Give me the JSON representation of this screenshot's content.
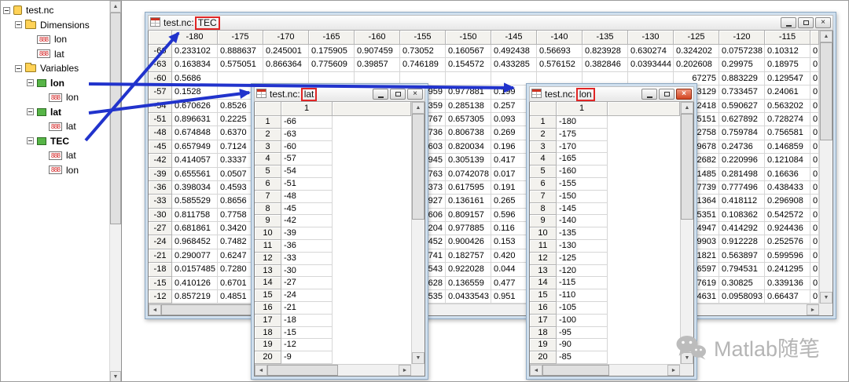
{
  "tree": {
    "items": [
      {
        "depth": 0,
        "label": "test.nc",
        "icon": "file",
        "expander": true,
        "bold": false
      },
      {
        "depth": 1,
        "label": "Dimensions",
        "icon": "folder",
        "expander": true,
        "bold": false
      },
      {
        "depth": 2,
        "label": "lon",
        "icon": "dim",
        "expander": false,
        "bold": false
      },
      {
        "depth": 2,
        "label": "lat",
        "icon": "dim",
        "expander": false,
        "bold": false
      },
      {
        "depth": 1,
        "label": "Variables",
        "icon": "folder",
        "expander": true,
        "bold": false
      },
      {
        "depth": 2,
        "label": "lon",
        "icon": "var",
        "expander": true,
        "bold": true
      },
      {
        "depth": 3,
        "label": "lon",
        "icon": "dim",
        "expander": false,
        "bold": false
      },
      {
        "depth": 2,
        "label": "lat",
        "icon": "var",
        "expander": true,
        "bold": true
      },
      {
        "depth": 3,
        "label": "lat",
        "icon": "dim",
        "expander": false,
        "bold": false
      },
      {
        "depth": 2,
        "label": "TEC",
        "icon": "var",
        "expander": true,
        "bold": true
      },
      {
        "depth": 3,
        "label": "lat",
        "icon": "dim",
        "expander": false,
        "bold": false
      },
      {
        "depth": 3,
        "label": "lon",
        "icon": "dim",
        "expander": false,
        "bold": false
      }
    ],
    "dim_icon_text": "888"
  },
  "windows": {
    "tec": {
      "title_prefix": "test.nc:",
      "title_box": "TEC",
      "columns": [
        "-180",
        "-175",
        "-170",
        "-165",
        "-160",
        "-155",
        "-150",
        "-145",
        "-140",
        "-135",
        "-130",
        "-125",
        "-120",
        "-115"
      ],
      "rows": [
        {
          "h": "-66",
          "c": [
            "0.233102",
            "0.888637",
            "0.245001",
            "0.175905",
            "0.907459",
            "0.73052",
            "0.160567",
            "0.492438",
            "0.56693",
            "0.823928",
            "0.630274",
            "0.324202",
            "0.0757238",
            "0.10312",
            "0"
          ]
        },
        {
          "h": "-63",
          "c": [
            "0.163834",
            "0.575051",
            "0.866364",
            "0.775609",
            "0.39857",
            "0.746189",
            "0.154572",
            "0.433285",
            "0.576152",
            "0.382846",
            "0.0393444",
            "0.202608",
            "0.29975",
            "0.18975",
            "0"
          ]
        },
        {
          "h": "-60",
          "c": [
            "0.5686",
            "",
            "",
            "",
            "",
            "",
            "",
            "",
            "",
            "",
            "",
            "67275",
            "0.883229",
            "0.129547",
            "0"
          ]
        },
        {
          "h": "-57",
          "c": [
            "0.1528",
            "",
            "",
            "",
            "",
            "1959",
            "0.977881",
            "0.199",
            "",
            "",
            "",
            "83129",
            "0.733457",
            "0.24061",
            "0"
          ]
        },
        {
          "h": "-54",
          "c": [
            "0.670626",
            "0.8526",
            "",
            "",
            "",
            "1359",
            "0.285138",
            "0.257",
            "",
            "",
            "",
            "92418",
            "0.590627",
            "0.563202",
            "0"
          ]
        },
        {
          "h": "-51",
          "c": [
            "0.896631",
            "0.2225",
            "",
            "",
            "",
            "7767",
            "0.657305",
            "0.093",
            "",
            "",
            "",
            "05151",
            "0.627892",
            "0.728274",
            "0"
          ]
        },
        {
          "h": "-48",
          "c": [
            "0.674848",
            "0.6370",
            "",
            "",
            "",
            "4736",
            "0.806738",
            "0.269",
            "",
            "",
            "",
            "02758",
            "0.759784",
            "0.756581",
            "0"
          ]
        },
        {
          "h": "-45",
          "c": [
            "0.657949",
            "0.7124",
            "",
            "",
            "",
            "2603",
            "0.820034",
            "0.196",
            "",
            "",
            "",
            "89678",
            "0.24736",
            "0.146859",
            "0"
          ]
        },
        {
          "h": "-42",
          "c": [
            "0.414057",
            "0.3337",
            "",
            "",
            "",
            "28945",
            "0.305139",
            "0.417",
            "",
            "",
            "",
            "932682",
            "0.220996",
            "0.121084",
            "0"
          ]
        },
        {
          "h": "-39",
          "c": [
            "0.655561",
            "0.0507",
            "",
            "",
            "",
            "9763",
            "0.0742078",
            "0.017",
            "",
            "",
            "",
            "01485",
            "0.281498",
            "0.16636",
            "0"
          ]
        },
        {
          "h": "-36",
          "c": [
            "0.398034",
            "0.4593",
            "",
            "",
            "",
            "7373",
            "0.617595",
            "0.191",
            "",
            "",
            "",
            "247739",
            "0.777496",
            "0.438433",
            "0"
          ]
        },
        {
          "h": "-33",
          "c": [
            "0.585529",
            "0.8656",
            "",
            "",
            "",
            "3927",
            "0.136161",
            "0.265",
            "",
            "",
            "",
            "81364",
            "0.418112",
            "0.296908",
            "0"
          ]
        },
        {
          "h": "-30",
          "c": [
            "0.811758",
            "0.7758",
            "",
            "",
            "",
            "55606",
            "0.809157",
            "0.596",
            "",
            "",
            "",
            "35351",
            "0.108362",
            "0.542572",
            "0"
          ]
        },
        {
          "h": "-27",
          "c": [
            "0.681861",
            "0.3420",
            "",
            "",
            "",
            "6204",
            "0.977885",
            "0.116",
            "",
            "",
            "",
            "4947",
            "0.414292",
            "0.924436",
            "0"
          ]
        },
        {
          "h": "-24",
          "c": [
            "0.968452",
            "0.7482",
            "",
            "",
            "",
            "2452",
            "0.900426",
            "0.153",
            "",
            "",
            "",
            "09903",
            "0.912228",
            "0.252576",
            "0"
          ]
        },
        {
          "h": "-21",
          "c": [
            "0.290077",
            "0.6247",
            "",
            "",
            "",
            "2741",
            "0.182757",
            "0.420",
            "",
            "",
            "",
            "31821",
            "0.563897",
            "0.599596",
            "0"
          ]
        },
        {
          "h": "-18",
          "c": [
            "0.0157485",
            "0.7280",
            "",
            "",
            "",
            "543",
            "0.922028",
            "0.044",
            "",
            "",
            "",
            "86597",
            "0.794531",
            "0.241295",
            "0"
          ]
        },
        {
          "h": "-15",
          "c": [
            "0.410126",
            "0.6701",
            "",
            "",
            "",
            "9628",
            "0.136559",
            "0.477",
            "",
            "",
            "",
            "87619",
            "0.30825",
            "0.339136",
            "0"
          ]
        },
        {
          "h": "-12",
          "c": [
            "0.857219",
            "0.4851",
            "",
            "",
            "",
            "4535",
            "0.0433543",
            "0.951",
            "",
            "",
            "",
            "64631",
            "0.0958093",
            "0.66437",
            "0"
          ]
        }
      ]
    },
    "lat": {
      "title_prefix": "test.nc:",
      "title_box": "lat",
      "col_header": "1",
      "rows": [
        [
          "1",
          "-66"
        ],
        [
          "2",
          "-63"
        ],
        [
          "3",
          "-60"
        ],
        [
          "4",
          "-57"
        ],
        [
          "5",
          "-54"
        ],
        [
          "6",
          "-51"
        ],
        [
          "7",
          "-48"
        ],
        [
          "8",
          "-45"
        ],
        [
          "9",
          "-42"
        ],
        [
          "10",
          "-39"
        ],
        [
          "11",
          "-36"
        ],
        [
          "12",
          "-33"
        ],
        [
          "13",
          "-30"
        ],
        [
          "14",
          "-27"
        ],
        [
          "15",
          "-24"
        ],
        [
          "16",
          "-21"
        ],
        [
          "17",
          "-18"
        ],
        [
          "18",
          "-15"
        ],
        [
          "19",
          "-12"
        ],
        [
          "20",
          "-9"
        ]
      ]
    },
    "lon": {
      "title_prefix": "test.nc:",
      "title_box": "lon",
      "col_header": "1",
      "rows": [
        [
          "1",
          "-180"
        ],
        [
          "2",
          "-175"
        ],
        [
          "3",
          "-170"
        ],
        [
          "4",
          "-165"
        ],
        [
          "5",
          "-160"
        ],
        [
          "6",
          "-155"
        ],
        [
          "7",
          "-150"
        ],
        [
          "8",
          "-145"
        ],
        [
          "9",
          "-140"
        ],
        [
          "10",
          "-135"
        ],
        [
          "11",
          "-130"
        ],
        [
          "12",
          "-125"
        ],
        [
          "13",
          "-120"
        ],
        [
          "14",
          "-115"
        ],
        [
          "15",
          "-110"
        ],
        [
          "16",
          "-105"
        ],
        [
          "17",
          "-100"
        ],
        [
          "18",
          "-95"
        ],
        [
          "19",
          "-90"
        ],
        [
          "20",
          "-85"
        ]
      ]
    }
  },
  "colors": {
    "arrow": "#2133cc",
    "highlight_box": "#e02525"
  },
  "watermark": {
    "text": "Matlab随笔"
  }
}
